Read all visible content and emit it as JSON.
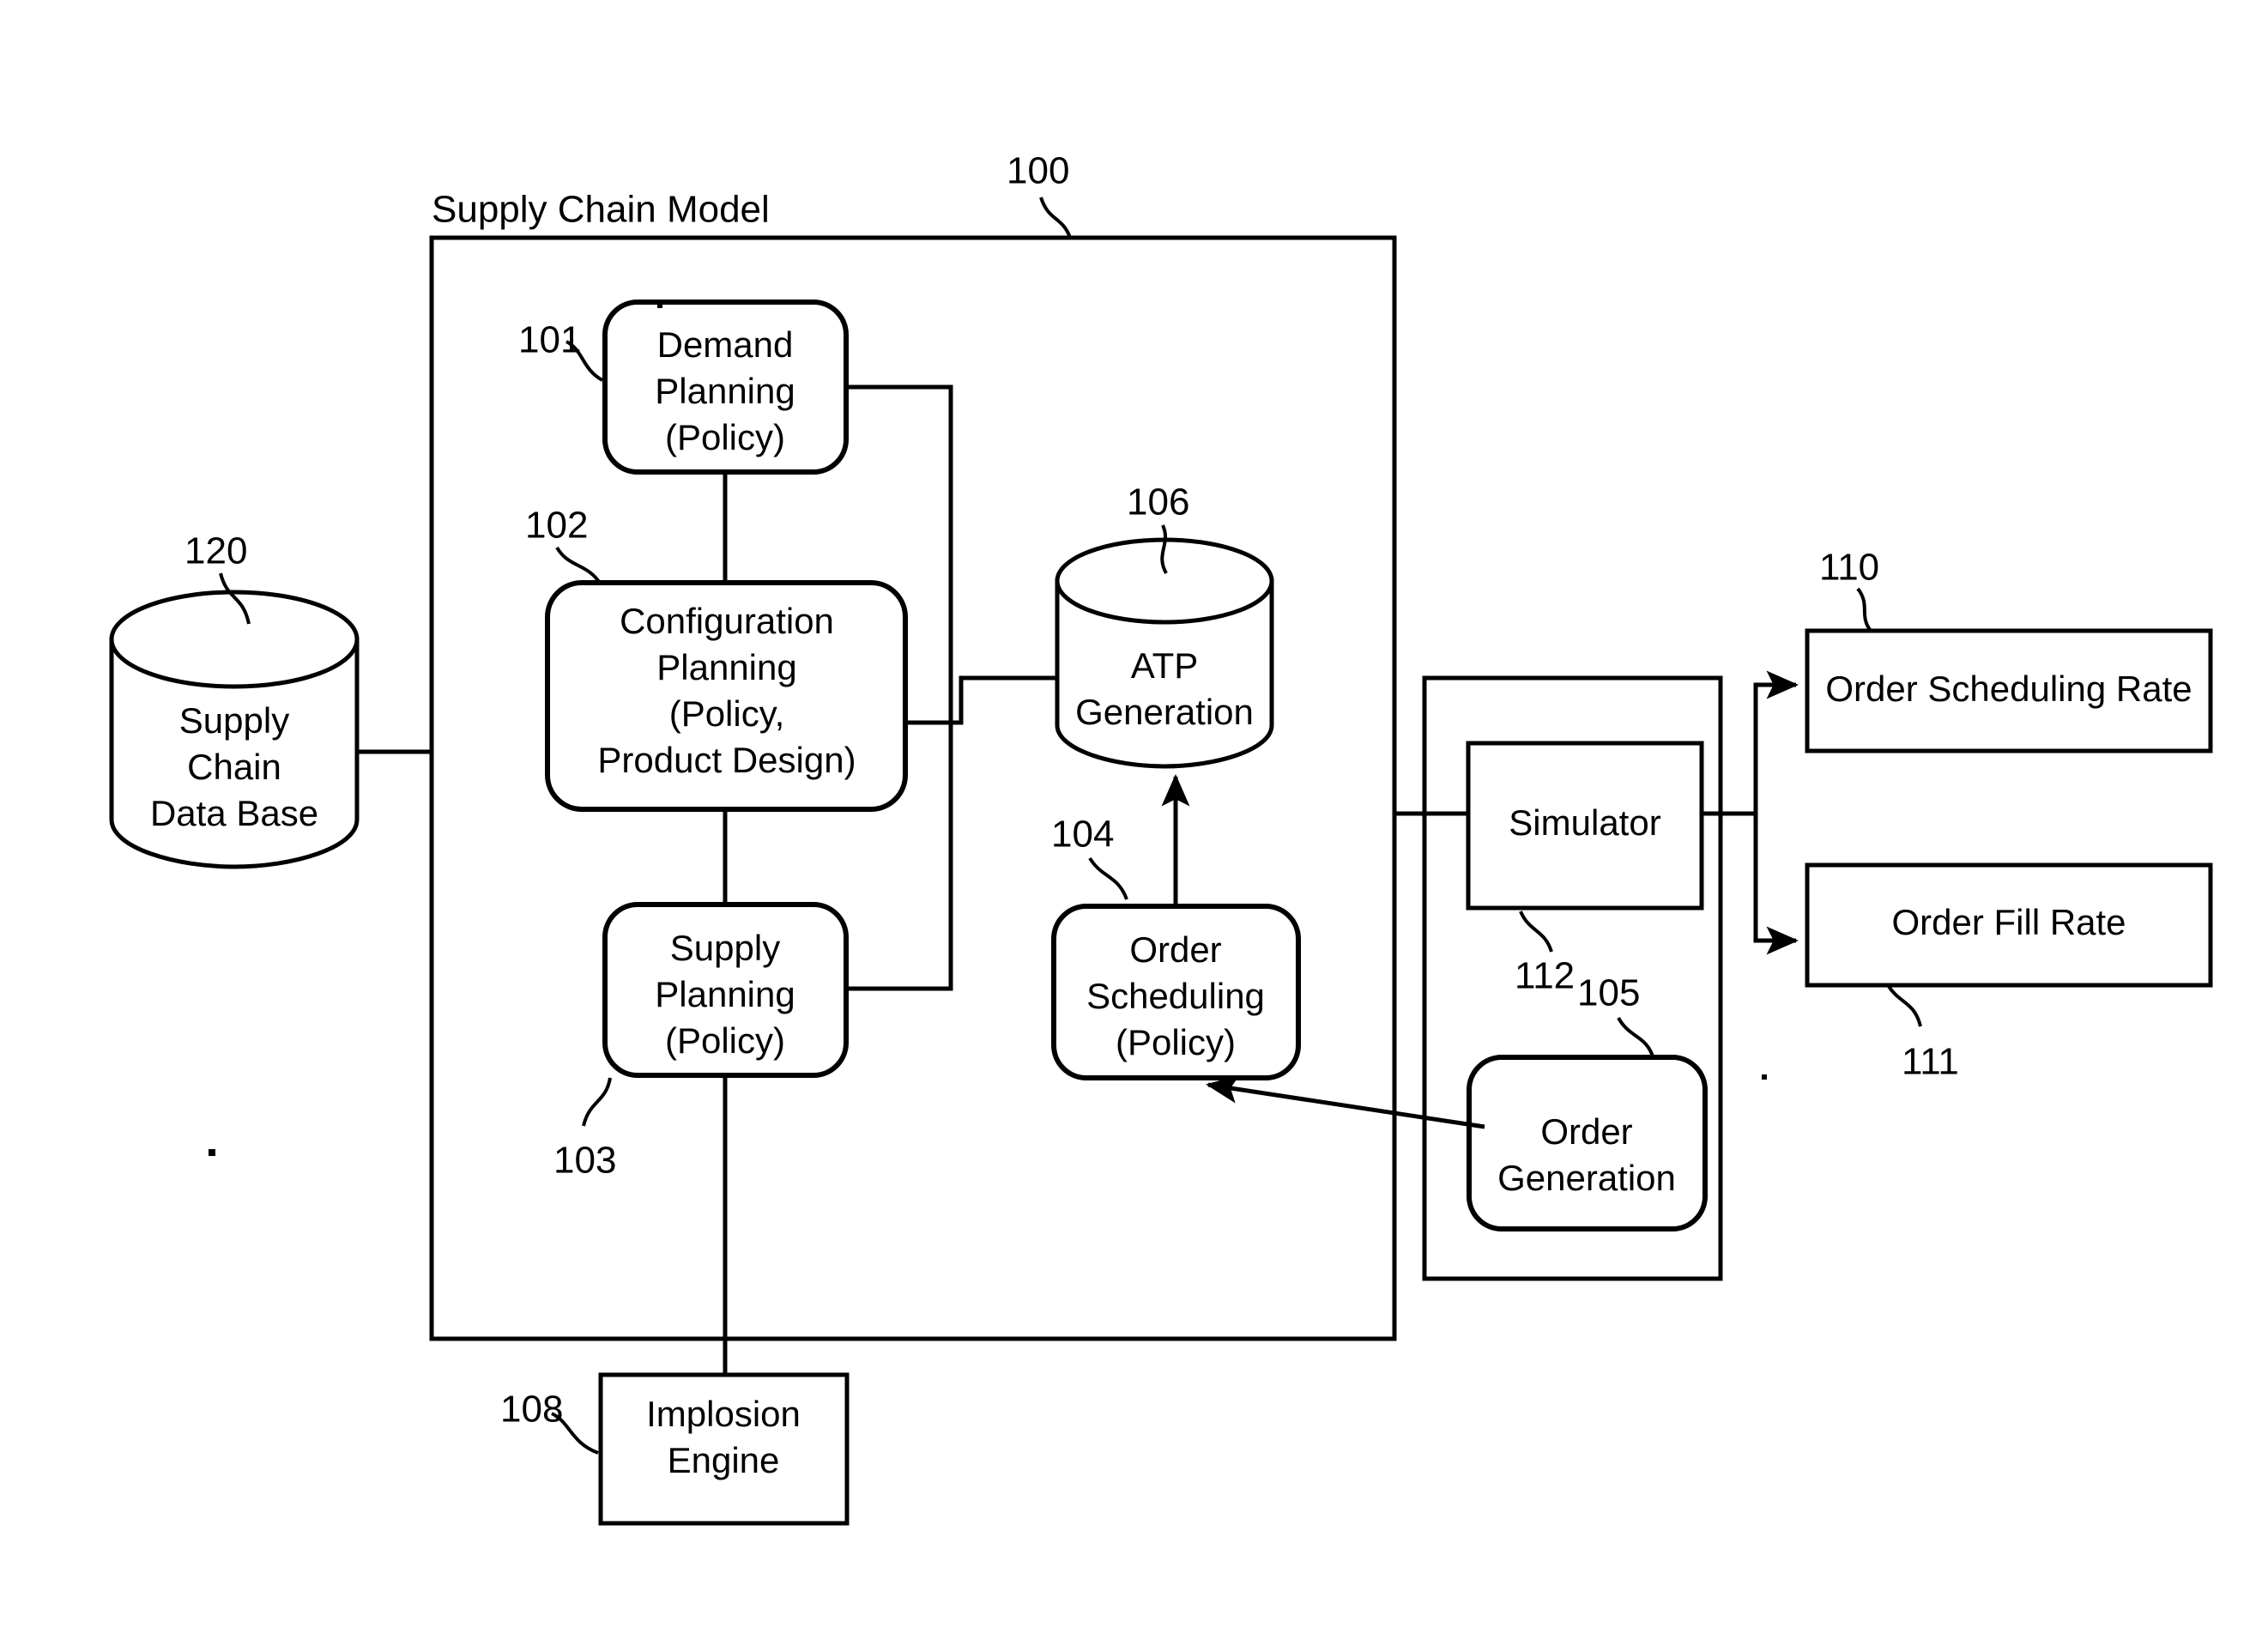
{
  "figure": {
    "container": {
      "title": "Supply Chain Model",
      "ref": "100"
    },
    "nodes": {
      "database": {
        "line1": "Supply",
        "line2": "Chain",
        "line3": "Data Base",
        "ref": "120",
        "shape": "cylinder"
      },
      "demand_planning": {
        "line1": "Demand",
        "line2": "Planning",
        "line3": "(Policy)",
        "ref": "101",
        "shape": "rounded-rect"
      },
      "configuration_planning": {
        "line1": "Configuration",
        "line2": "Planning",
        "line3": "(Policy,",
        "line4": "Product Design)",
        "ref": "102",
        "shape": "rounded-rect"
      },
      "supply_planning": {
        "line1": "Supply",
        "line2": "Planning",
        "line3": "(Policy)",
        "ref": "103",
        "shape": "rounded-rect"
      },
      "order_scheduling": {
        "line1": "Order",
        "line2": "Scheduling",
        "line3": "(Policy)",
        "ref": "104",
        "shape": "rounded-rect"
      },
      "atp_generation": {
        "line1": "ATP",
        "line2": "Generation",
        "ref": "106",
        "shape": "cylinder"
      },
      "implosion_engine": {
        "line1": "Implosion",
        "line2": "Engine",
        "ref": "108",
        "shape": "rect"
      },
      "simulator": {
        "line1": "Simulator",
        "ref": "112",
        "shape": "rect"
      },
      "order_generation": {
        "line1": "Order",
        "line2": "Generation",
        "ref": "105",
        "shape": "rounded-rect"
      },
      "order_scheduling_rate": {
        "line1": "Order Scheduling Rate",
        "ref": "110",
        "shape": "rect"
      },
      "order_fill_rate": {
        "line1": "Order Fill Rate",
        "ref": "111",
        "shape": "rect"
      }
    },
    "colors": {
      "stroke": "#000000",
      "fill": "#ffffff"
    }
  }
}
